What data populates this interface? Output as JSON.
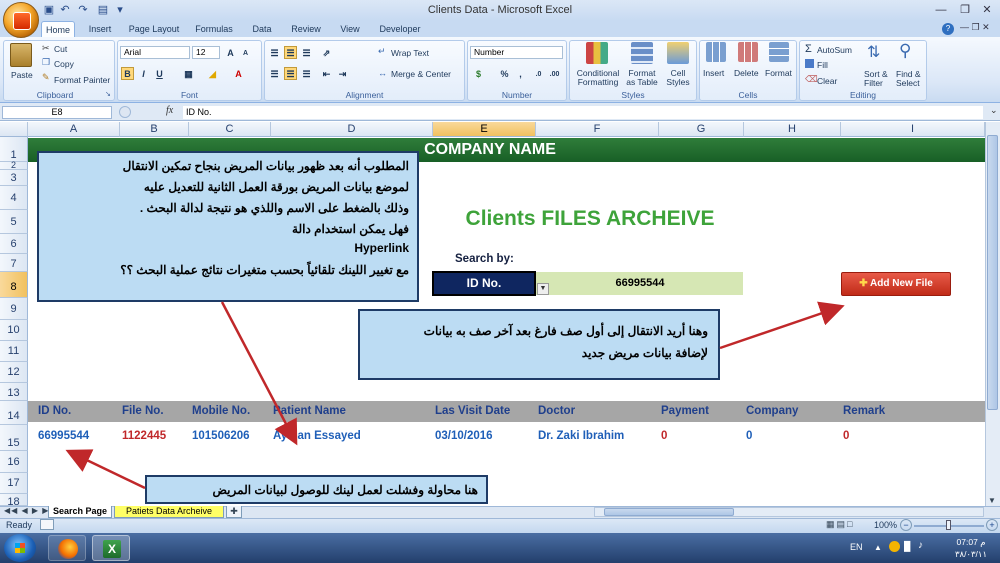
{
  "window": {
    "title": "Clients Data - Microsoft Excel"
  },
  "ribbon": {
    "tabs": [
      "Home",
      "Insert",
      "Page Layout",
      "Formulas",
      "Data",
      "Review",
      "View",
      "Developer"
    ],
    "clipboard": {
      "paste": "Paste",
      "cut": "Cut",
      "copy": "Copy",
      "format_painter": "Format Painter",
      "label": "Clipboard"
    },
    "font": {
      "name": "Arial",
      "size": "12",
      "label": "Font"
    },
    "alignment": {
      "wrap_text": "Wrap Text",
      "merge_center": "Merge & Center",
      "label": "Alignment"
    },
    "number": {
      "format": "Number",
      "label": "Number"
    },
    "styles": {
      "conditional": "Conditional",
      "conditional2": "Formatting",
      "format_as": "Format",
      "format_as2": "as Table",
      "cell": "Cell",
      "cell2": "Styles",
      "label": "Styles"
    },
    "cells": {
      "insert": "Insert",
      "delete": "Delete",
      "format": "Format",
      "label": "Cells"
    },
    "editing": {
      "autosum": "AutoSum",
      "fill": "Fill",
      "clear": "Clear",
      "sort": "Sort &",
      "sort2": "Filter",
      "find": "Find &",
      "find2": "Select",
      "label": "Editing"
    }
  },
  "formula_bar": {
    "name_box": "E8",
    "fx": "fx",
    "content": "ID No."
  },
  "columns": [
    "A",
    "B",
    "C",
    "D",
    "E",
    "F",
    "G",
    "H",
    "I"
  ],
  "rows": [
    "1",
    "2",
    "3",
    "4",
    "5",
    "6",
    "7",
    "8",
    "9",
    "10",
    "11",
    "12",
    "13",
    "14",
    "15",
    "16",
    "17",
    "18"
  ],
  "sheet": {
    "company_name": "COMPANY NAME",
    "archive_title": "Clients FILES ARCHEIVE",
    "search_label": "Search by:",
    "search_field": "ID No.",
    "search_value": "66995544",
    "add_button": "Add New File",
    "headers": [
      "ID No.",
      "File No.",
      "Mobile No.",
      "Patient Name",
      "Las Visit Date",
      "Doctor",
      "Payment",
      "Company",
      "Remark"
    ],
    "record": [
      "66995544",
      "1122445",
      "101506206",
      "Ayman Essayed",
      "03/10/2016",
      "Dr. Zaki Ibrahim",
      "0",
      "0",
      "0"
    ]
  },
  "callouts": {
    "main": [
      "المطلوب  أنه بعد ظهور بيانات المريض بنجاح تمكين الانتقال",
      "لموضع بيانات المريض بورقة العمل الثانية للتعديل عليه",
      "وذلك بالضغط على الاسم واللذي هو نتيجة لدالة البحث .",
      "فهل يمكن استخدام دالة",
      "Hyperlink",
      "مع تغيير اللينك تلقائياً بحسب متغيرات نتائج عملية البحث ؟؟"
    ],
    "right": [
      "وهنا أريد الانتقال إلى أول صف فارغ بعد آخر صف به بيانات",
      "لإضافة بيانات مريض جديد"
    ],
    "bottom": "هنا محاولة وفشلت لعمل لينك للوصول لبيانات المريض"
  },
  "sheet_tabs": [
    "Search Page",
    "Patiets Data Archeive"
  ],
  "status": {
    "ready": "Ready",
    "zoom": "100%"
  },
  "taskbar": {
    "lang": "EN",
    "time": "07:07 م",
    "date": "٣٨/٠٣/١١"
  },
  "colors": {
    "banner": "#1e6b2e",
    "title_green": "#3ea33a",
    "header_band": "#a6a6a6",
    "callout": "#bcdcf3",
    "arrow": "#c0282a",
    "add_button": "#d33a27"
  }
}
